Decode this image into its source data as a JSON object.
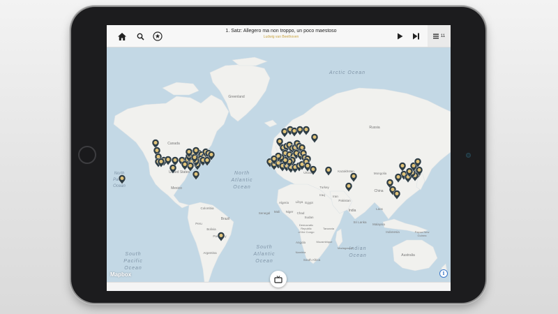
{
  "player": {
    "title": "1. Satz: Allegero ma non troppo, un poco maestoso",
    "subtitle": "Ludwig van Beethoven",
    "queue_count": "11",
    "accent_color": "#c9a441"
  },
  "toolbar": {
    "home_icon": "home-icon",
    "search_icon": "search-icon",
    "favorites_icon": "star-circle-icon",
    "play_icon": "play-icon",
    "skip_icon": "skip-forward-icon",
    "queue_icon": "list-icon"
  },
  "map": {
    "labels": {
      "arctic_ocean": "Arctic Ocean",
      "greenland": "Greenland",
      "canada": "Canada",
      "united_states": "United States",
      "mexico": "Mexico",
      "colombia": "Colombia",
      "peru": "Peru",
      "brazil": "Brazil",
      "bolivia": "Bolivia",
      "paraguay": "Paraguay",
      "argentina": "Argentina",
      "north_pacific_1": "North",
      "north_pacific_2": "Pacific",
      "north_pacific_3": "Ocean",
      "north_atlantic_1": "North",
      "north_atlantic_2": "Atlantic",
      "north_atlantic_3": "Ocean",
      "south_atlantic_1": "South",
      "south_atlantic_2": "Atlantic",
      "south_atlantic_3": "Ocean",
      "south_pacific_1": "South",
      "south_pacific_2": "Pacific",
      "south_pacific_3": "Ocean",
      "indian_ocean_1": "Indian",
      "indian_ocean_2": "Ocean",
      "russia": "Russia",
      "belarus": "Belarus",
      "ukraine": "Ukraine",
      "kazakhstan": "Kazakhstan",
      "mongolia": "Mongolia",
      "china": "China",
      "turkey": "Turkey",
      "iran": "Iran",
      "iraq": "Iraq",
      "algeria": "Algeria",
      "libya": "Libya",
      "egypt": "Egypt",
      "mali": "Mali",
      "niger": "Niger",
      "chad": "Chad",
      "sudan": "Sudan",
      "senegal": "Senegal",
      "pakistan": "Pakistan",
      "india": "India",
      "laos": "Laos",
      "sri_lanka": "Sri Lanka",
      "malaysia": "Malaysia",
      "indonesia": "Indonesia",
      "png_1": "Papua New",
      "png_2": "Guinea",
      "australia": "Australia",
      "drc_1": "Democratic",
      "drc_2": "Republic",
      "drc_3": "of the Congo",
      "angola": "Angola",
      "madagascar": "Madagascar",
      "namibia": "Namibia",
      "south_africa": "South Africa",
      "tanzania": "Tanzania",
      "mozambique": "Mozambique"
    },
    "attribution": "Mapbox",
    "info": "i",
    "colors": {
      "water": "#c3d8e5",
      "land": "#f1f1ee",
      "pin": "#2f3e46",
      "pin_center": "#e2c47a"
    }
  },
  "bottom": {
    "button_icon": "tv-icon"
  }
}
